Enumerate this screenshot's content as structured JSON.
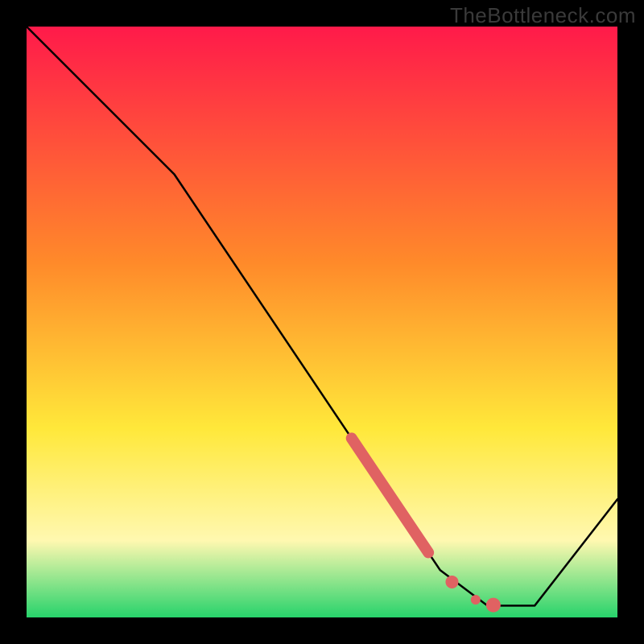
{
  "watermark": "TheBottleneck.com",
  "colors": {
    "gradient_top": "#ff1a4a",
    "gradient_mid1": "#ff8a2a",
    "gradient_mid2": "#ffe83a",
    "gradient_mid3": "#fff8b0",
    "gradient_bottom": "#27d36b",
    "curve": "#000000",
    "marker_fill": "#e06262",
    "marker_stroke": "#c44848",
    "frame": "#000000"
  },
  "chart_data": {
    "type": "line",
    "title": "",
    "xlabel": "",
    "ylabel": "",
    "xlim": [
      0,
      100
    ],
    "ylim": [
      0,
      100
    ],
    "curve_points": [
      {
        "x": 0,
        "y": 100
      },
      {
        "x": 25,
        "y": 75
      },
      {
        "x": 70,
        "y": 8
      },
      {
        "x": 78,
        "y": 2
      },
      {
        "x": 86,
        "y": 2
      },
      {
        "x": 100,
        "y": 20
      }
    ],
    "highlight_segment": {
      "start": {
        "x": 55,
        "y": 30.33
      },
      "end": {
        "x": 68,
        "y": 10.98
      }
    },
    "highlight_dots": [
      {
        "x": 72,
        "y": 6.0
      },
      {
        "x": 76,
        "y": 3.0
      },
      {
        "x": 79,
        "y": 2.1
      }
    ]
  }
}
